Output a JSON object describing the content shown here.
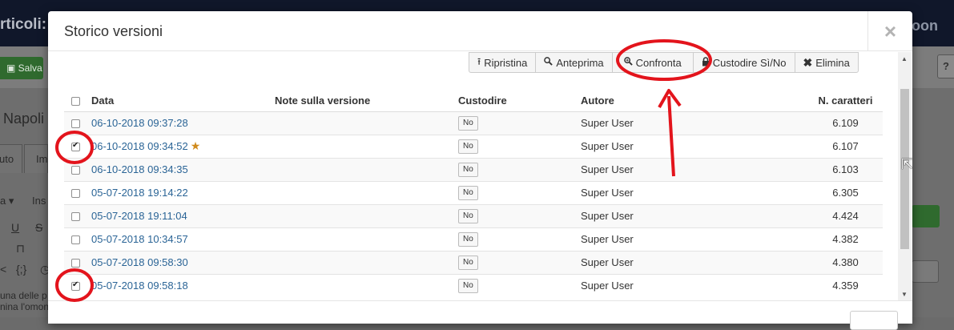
{
  "background": {
    "page_title_fragment": "rticoli: I",
    "logo_fragment": "oon",
    "save_label": "Salva",
    "help_label": "?",
    "article_name_fragment": "Napoli",
    "tab_labels": [
      "uto",
      "Im"
    ],
    "menu_labels": [
      "a ▾",
      "Ins"
    ],
    "body_text_lines": [
      "una delle p",
      "nina l'omon"
    ]
  },
  "modal": {
    "title": "Storico versioni",
    "close_label": "×",
    "toolbar": [
      {
        "label": "Ripristina",
        "icon": "upload-icon"
      },
      {
        "label": "Anteprima",
        "icon": "search-icon"
      },
      {
        "label": "Confronta",
        "icon": "zoom-in-icon"
      },
      {
        "label": "Custodire Sì/No",
        "icon": "lock-icon"
      },
      {
        "label": "Elimina",
        "icon": "close-icon"
      }
    ],
    "table": {
      "headers": {
        "date": "Data",
        "notes": "Note sulla versione",
        "keep": "Custodire",
        "author": "Autore",
        "chars": "N. caratteri"
      },
      "rows": [
        {
          "date": "06-10-2018 09:37:28",
          "notes": "",
          "keep": "No",
          "author": "Super User",
          "chars": "6.109",
          "checked": false,
          "starred": false
        },
        {
          "date": "06-10-2018 09:34:52",
          "notes": "",
          "keep": "No",
          "author": "Super User",
          "chars": "6.107",
          "checked": true,
          "starred": true
        },
        {
          "date": "06-10-2018 09:34:35",
          "notes": "",
          "keep": "No",
          "author": "Super User",
          "chars": "6.103",
          "checked": false,
          "starred": false
        },
        {
          "date": "05-07-2018 19:14:22",
          "notes": "",
          "keep": "No",
          "author": "Super User",
          "chars": "6.305",
          "checked": false,
          "starred": false
        },
        {
          "date": "05-07-2018 19:11:04",
          "notes": "",
          "keep": "No",
          "author": "Super User",
          "chars": "4.424",
          "checked": false,
          "starred": false
        },
        {
          "date": "05-07-2018 10:34:57",
          "notes": "",
          "keep": "No",
          "author": "Super User",
          "chars": "4.382",
          "checked": false,
          "starred": false
        },
        {
          "date": "05-07-2018 09:58:30",
          "notes": "",
          "keep": "No",
          "author": "Super User",
          "chars": "4.380",
          "checked": false,
          "starred": false
        },
        {
          "date": "05-07-2018 09:58:18",
          "notes": "",
          "keep": "No",
          "author": "Super User",
          "chars": "4.359",
          "checked": true,
          "starred": false
        }
      ]
    }
  },
  "colors": {
    "link": "#2a6496",
    "star": "#d08a1c",
    "annotation": "#e3141c",
    "save_button": "#2f6a2e"
  }
}
